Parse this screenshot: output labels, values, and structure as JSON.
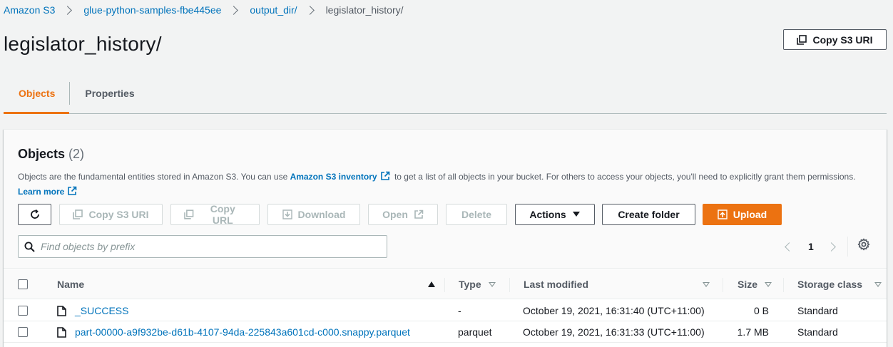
{
  "breadcrumb": {
    "items": [
      {
        "label": "Amazon S3"
      },
      {
        "label": "glue-python-samples-fbe445ee"
      },
      {
        "label": "output_dir/"
      }
    ],
    "current": "legislator_history/"
  },
  "header": {
    "title": "legislator_history/",
    "copy_uri_label": "Copy S3 URI"
  },
  "tabs": [
    {
      "label": "Objects",
      "active": true
    },
    {
      "label": "Properties",
      "active": false
    }
  ],
  "objects_panel": {
    "title": "Objects",
    "count": "(2)",
    "desc_part1": "Objects are the fundamental entities stored in Amazon S3. You can use ",
    "inventory_link": "Amazon S3 inventory",
    "desc_part2": " to get a list of all objects in your bucket. For others to access your objects, you'll need to explicitly grant them permissions.",
    "learn_more": "Learn more",
    "toolbar": {
      "copy_uri": "Copy S3 URI",
      "copy_url": "Copy URL",
      "download": "Download",
      "open": "Open",
      "delete": "Delete",
      "actions": "Actions",
      "create_folder": "Create folder",
      "upload": "Upload"
    },
    "search": {
      "placeholder": "Find objects by prefix",
      "value": ""
    },
    "pagination": {
      "current_page": "1"
    }
  },
  "table": {
    "columns": {
      "name": "Name",
      "type": "Type",
      "last_modified": "Last modified",
      "size": "Size",
      "storage_class": "Storage class"
    },
    "rows": [
      {
        "name": "_SUCCESS",
        "type": "-",
        "last_modified": "October 19, 2021, 16:31:40 (UTC+11:00)",
        "size": "0 B",
        "storage_class": "Standard"
      },
      {
        "name": "part-00000-a9f932be-d61b-4107-94da-225843a601cd-c000.snappy.parquet",
        "type": "parquet",
        "last_modified": "October 19, 2021, 16:31:33 (UTC+11:00)",
        "size": "1.7 MB",
        "storage_class": "Standard"
      }
    ]
  },
  "colors": {
    "accent": "#ec7211",
    "link": "#0073bb",
    "text": "#16191f",
    "background": "#f2f3f3"
  }
}
